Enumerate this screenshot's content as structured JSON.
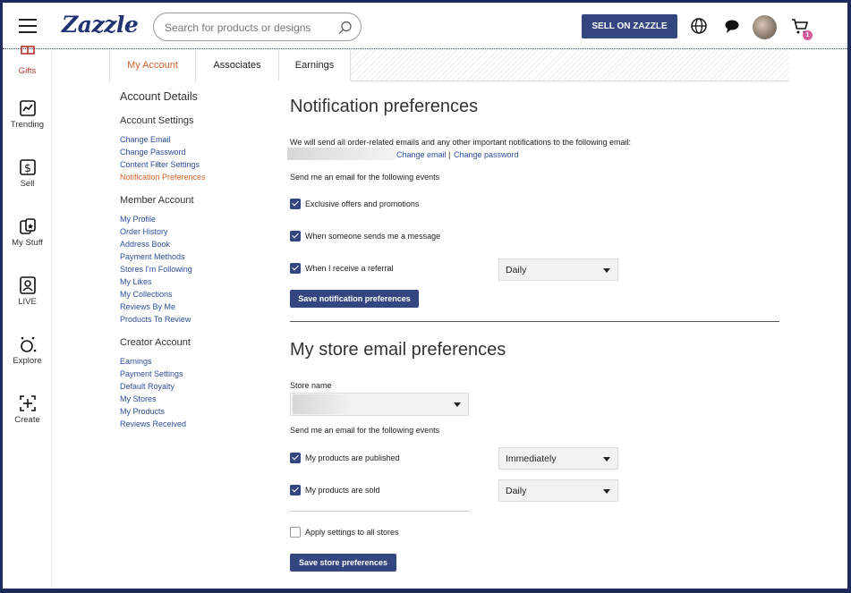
{
  "header": {
    "logo": "Zazzle",
    "search_placeholder": "Search for products or designs",
    "sell_label": "SELL ON ZAZZLE",
    "cart_count": "1"
  },
  "rail": {
    "items": [
      {
        "label": "Gifts"
      },
      {
        "label": "Trending"
      },
      {
        "label": "Sell"
      },
      {
        "label": "My Stuff"
      },
      {
        "label": "LIVE"
      },
      {
        "label": "Explore"
      },
      {
        "label": "Create"
      }
    ]
  },
  "tabs": [
    {
      "label": "My Account"
    },
    {
      "label": "Associates"
    },
    {
      "label": "Earnings"
    }
  ],
  "account_nav": {
    "title": "Account Details",
    "settings": {
      "heading": "Account Settings",
      "links": [
        "Change Email",
        "Change Password",
        "Content Filter Settings",
        "Notification Preferences"
      ]
    },
    "member": {
      "heading": "Member Account",
      "links": [
        "My Profile",
        "Order History",
        "Address Book",
        "Payment Methods",
        "Stores I'm Following",
        "My Likes",
        "My Collections",
        "Reviews By Me",
        "Products To Review"
      ]
    },
    "creator": {
      "heading": "Creator Account",
      "links": [
        "Earnings",
        "Payment Settings",
        "Default Royalty",
        "My Stores",
        "My Products",
        "Reviews Received"
      ]
    }
  },
  "notifications": {
    "title": "Notification preferences",
    "intro": "We will send all order-related emails and any other important notifications to the following email:",
    "change_email": "Change email",
    "separator": "|",
    "change_password": "Change password",
    "events_label": "Send me an email for the following events",
    "options": [
      {
        "label": "Exclusive offers and promotions",
        "checked": true
      },
      {
        "label": "When someone sends me a message",
        "checked": true
      },
      {
        "label": "When I receive a referral",
        "checked": true,
        "frequency": "Daily"
      }
    ],
    "save_label": "Save notification preferences"
  },
  "store": {
    "title": "My store email preferences",
    "store_name_label": "Store name",
    "events_label": "Send me an email for the following events",
    "options": [
      {
        "label": "My products are published",
        "checked": true,
        "frequency": "Immediately"
      },
      {
        "label": "My products are sold",
        "checked": true,
        "frequency": "Daily"
      }
    ],
    "apply_all_label": "Apply settings to all stores",
    "apply_all_checked": false,
    "save_label": "Save store preferences"
  },
  "colors": {
    "brand_navy": "#33467f",
    "accent_orange": "#d0622e",
    "link_blue": "#2c4e9a",
    "badge_pink": "#d45b9a"
  }
}
